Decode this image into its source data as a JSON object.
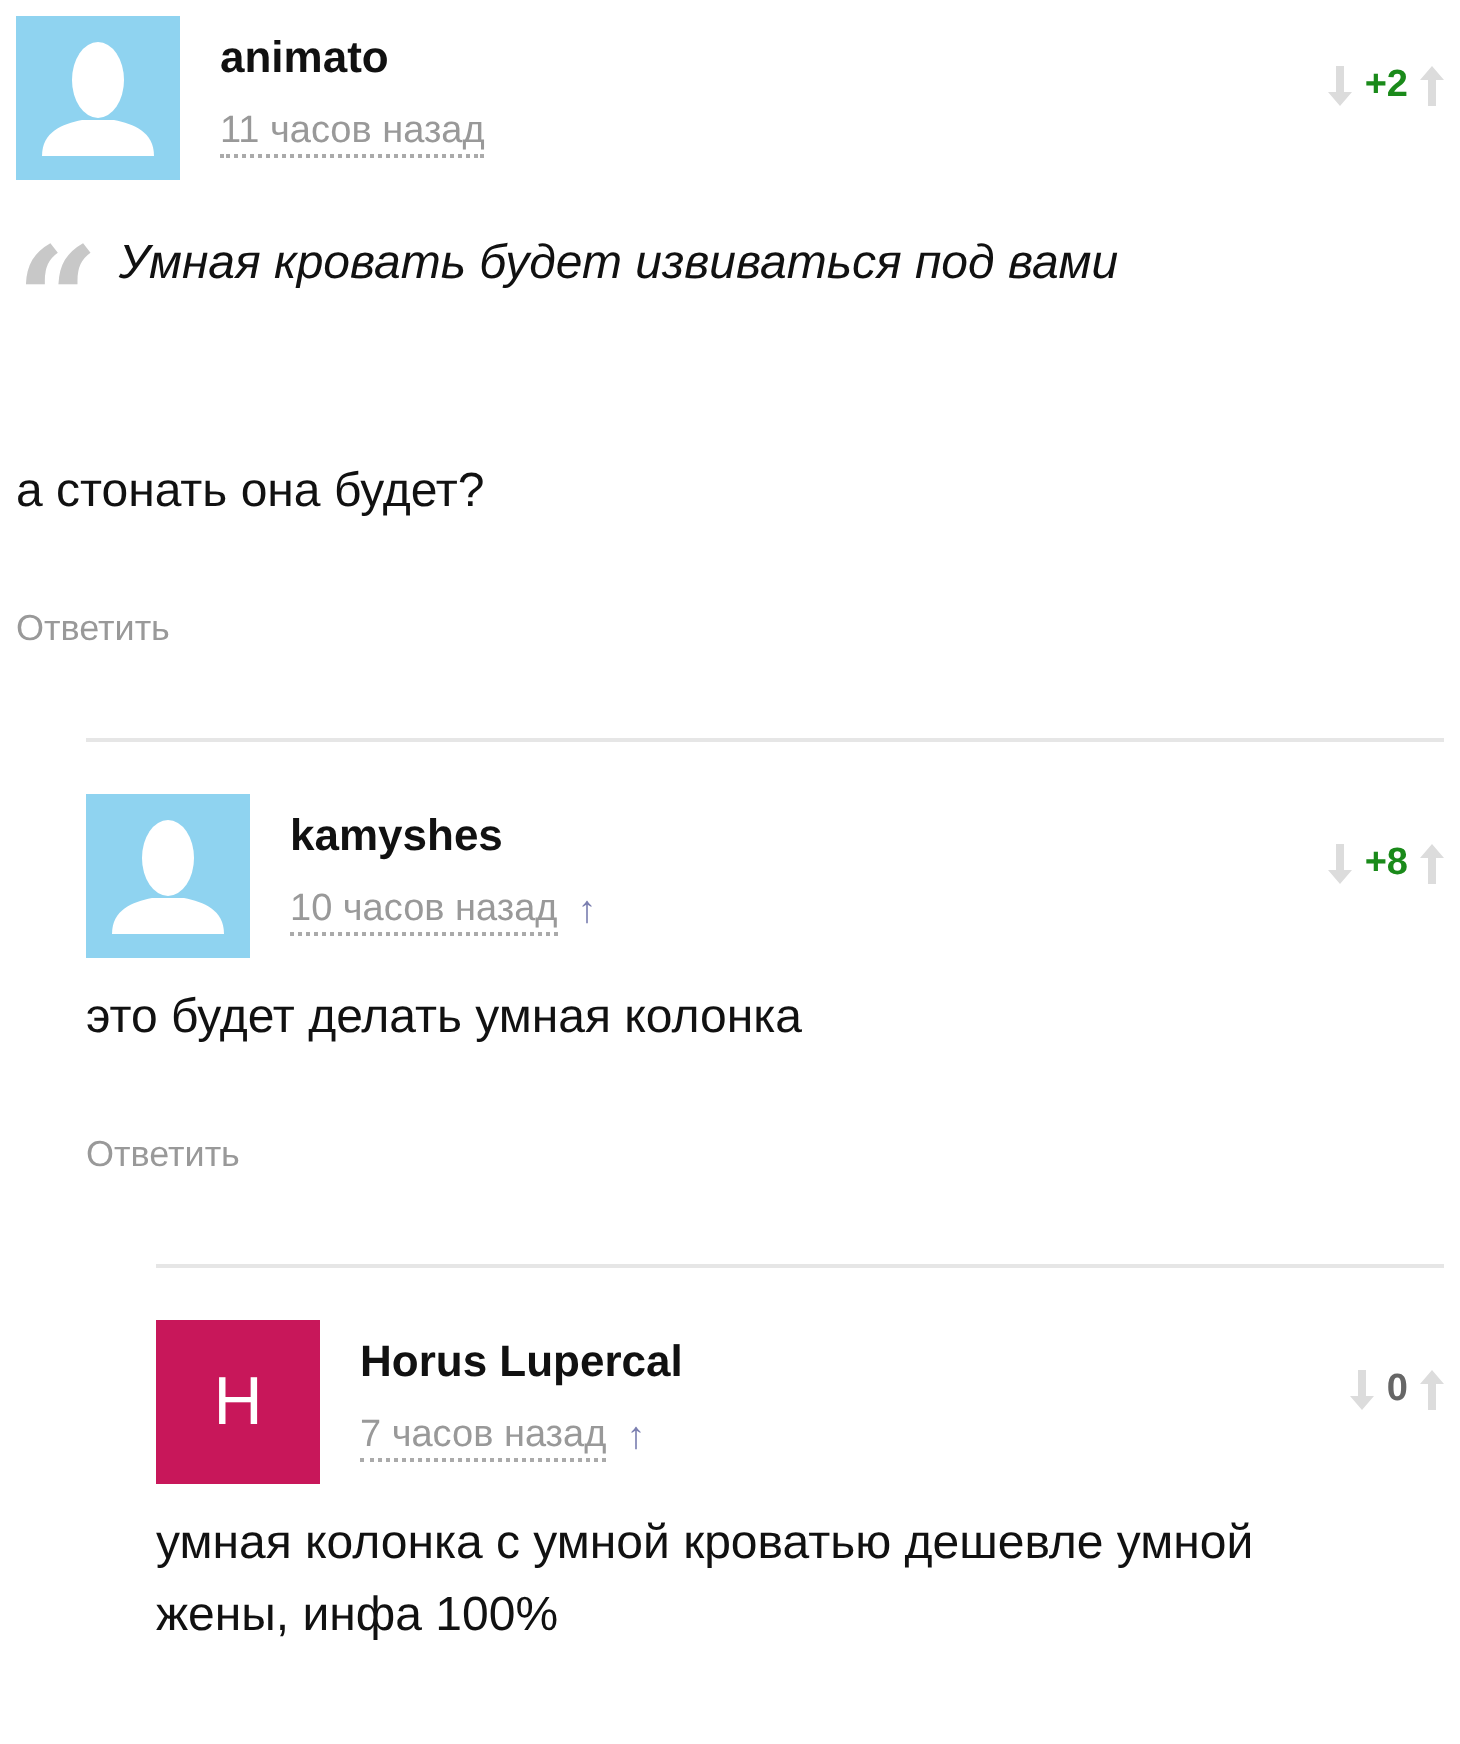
{
  "comments": [
    {
      "author": "animato",
      "time": "11 часов назад",
      "avatar": {
        "kind": "silhouette"
      },
      "score": {
        "text": "+2",
        "color": "#1a8a1a"
      },
      "quote": "Умная кровать будет извиваться под вами",
      "quote_mark": "“",
      "text": "а стонать она будет?",
      "reply": "Ответить"
    },
    {
      "author": "kamyshes",
      "time": "10 часов назад",
      "parent_link": "↑",
      "avatar": {
        "kind": "silhouette"
      },
      "score": {
        "text": "+8",
        "color": "#1a8a1a"
      },
      "text": "это будет делать умная колонка",
      "reply": "Ответить"
    },
    {
      "author": "Horus Lupercal",
      "time": "7 часов назад",
      "parent_link": "↑",
      "avatar": {
        "kind": "letter",
        "letter": "H",
        "color": "#c8175a"
      },
      "score": {
        "text": "0",
        "color": "#666666"
      },
      "text": "умная колонка с умной кроватью дешевле умной жены, инфа 100%"
    }
  ]
}
